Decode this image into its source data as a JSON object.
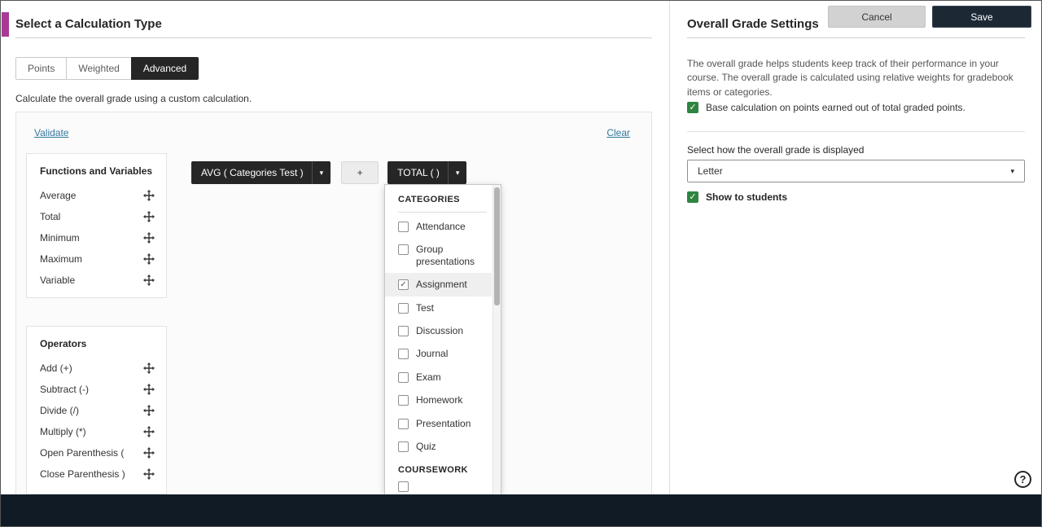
{
  "left": {
    "title": "Select a Calculation Type",
    "tabs": [
      {
        "label": "Points",
        "active": false
      },
      {
        "label": "Weighted",
        "active": false
      },
      {
        "label": "Advanced",
        "active": true
      }
    ],
    "description": "Calculate the overall grade using a custom calculation.",
    "builder": {
      "validate_link": "Validate",
      "clear_link": "Clear",
      "functions_card": {
        "title": "Functions and Variables",
        "items": [
          {
            "label": "Average"
          },
          {
            "label": "Total"
          },
          {
            "label": "Minimum"
          },
          {
            "label": "Maximum"
          },
          {
            "label": "Variable"
          }
        ]
      },
      "operators_card": {
        "title": "Operators",
        "items": [
          {
            "label": "Add (+)"
          },
          {
            "label": "Subtract (-)"
          },
          {
            "label": "Divide (/)"
          },
          {
            "label": "Multiply (*)"
          },
          {
            "label": "Open Parenthesis ("
          },
          {
            "label": "Close Parenthesis )"
          }
        ]
      },
      "expression": {
        "avg_chip": "AVG ( Categories Test )",
        "plus_chip": "+",
        "total_chip": "TOTAL ( )"
      },
      "dropdown": {
        "sections": [
          {
            "header": "CATEGORIES",
            "items": [
              {
                "label": "Attendance",
                "checked": false
              },
              {
                "label": "Group presentations",
                "checked": false
              },
              {
                "label": "Assignment",
                "checked": true,
                "highlighted": true
              },
              {
                "label": "Test",
                "checked": false
              },
              {
                "label": "Discussion",
                "checked": false
              },
              {
                "label": "Journal",
                "checked": false
              },
              {
                "label": "Exam",
                "checked": false
              },
              {
                "label": "Homework",
                "checked": false
              },
              {
                "label": "Presentation",
                "checked": false
              },
              {
                "label": "Quiz",
                "checked": false
              }
            ]
          },
          {
            "header": "COURSEWORK",
            "items": [
              {
                "label": "",
                "checked": false
              }
            ]
          }
        ]
      }
    }
  },
  "right": {
    "title": "Overall Grade Settings",
    "description": "The overall grade helps students keep track of their performance in your course. The overall grade is calculated using relative weights for gradebook items or categories.",
    "base_points_checkbox": {
      "label": "Base calculation on points earned out of total graded points.",
      "checked": true
    },
    "display_label": "Select how the overall grade is displayed",
    "display_select": {
      "value": "Letter"
    },
    "show_students_checkbox": {
      "label": "Show to students",
      "checked": true
    }
  },
  "footer": {
    "cancel_label": "Cancel",
    "save_label": "Save"
  },
  "icons": {
    "caret_down": "▾",
    "check": "✓",
    "help": "?"
  },
  "colors": {
    "accent": "#a83a95",
    "chip_dark": "#262626",
    "checkbox_green": "#2e8540",
    "footer_bg": "#101b26",
    "link": "#35789f"
  }
}
